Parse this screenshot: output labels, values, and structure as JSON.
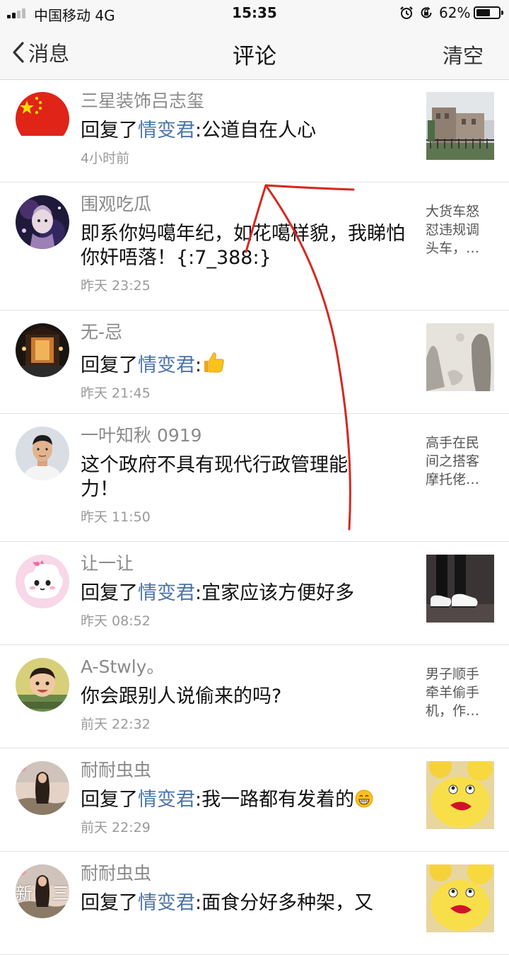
{
  "status_bar": {
    "carrier": "中国移动  4G",
    "time": "15:35",
    "battery_percent": "62%",
    "battery_level": 0.62
  },
  "nav": {
    "back_label": "消息",
    "title": "评论",
    "clear_label": "清空"
  },
  "comments": [
    {
      "username": "三星装饰吕志玺",
      "prefix": "回复了",
      "target": "情变君",
      "text": ":公道自在人心",
      "time": "4小时前",
      "avatar": "china-flag",
      "attachment": "thumbnail",
      "thumb": "building-photo"
    },
    {
      "username": "围观吃瓜",
      "prefix": "",
      "target": "",
      "text": "即系你妈噶年纪，如花噶样貌，我睇怕你奸唔落！{:7_388:}",
      "time": "昨天 23:25",
      "avatar": "anime-character",
      "attachment": "snippet",
      "snippet": "大货车怒怼违规调头车，…"
    },
    {
      "username": "无-忌",
      "prefix": "回复了",
      "target": "情变君",
      "text": ":",
      "emoji": "thumbs-up",
      "time": "昨天 21:45",
      "avatar": "temple",
      "attachment": "thumbnail",
      "thumb": "ink-painting"
    },
    {
      "username": "一叶知秋 0919",
      "prefix": "",
      "target": "",
      "text": "这个政府不具有现代行政管理能力！",
      "time": "昨天 11:50",
      "avatar": "man-portrait",
      "attachment": "snippet",
      "snippet": "高手在民间之搭客摩托佬…"
    },
    {
      "username": "让一让",
      "prefix": "回复了",
      "target": "情变君",
      "text": ":宜家应该方便好多",
      "time": "昨天 08:52",
      "avatar": "cartoon-cloud",
      "attachment": "thumbnail",
      "thumb": "sneakers-photo"
    },
    {
      "username": "A-Stwly。",
      "prefix": "",
      "target": "",
      "text": "你会跟别人说偷来的吗?",
      "time": "前天 22:32",
      "avatar": "child-photo",
      "attachment": "snippet",
      "snippet": "男子顺手牵羊偷手机，作…"
    },
    {
      "username": "耐耐虫虫",
      "prefix": "回复了",
      "target": "情变君",
      "text": ":我一路都有发着的",
      "emoji": "grin",
      "time": "前天 22:29",
      "avatar": "girl-photo",
      "attachment": "thumbnail",
      "thumb": "emoji-buns"
    },
    {
      "username": "耐耐虫虫",
      "prefix": "回复了",
      "target": "情变君",
      "text": ":面食分好多种架，又",
      "time": "",
      "avatar": "girl-photo",
      "attachment": "thumbnail",
      "thumb": "emoji-buns"
    }
  ],
  "watermark": "新 三"
}
